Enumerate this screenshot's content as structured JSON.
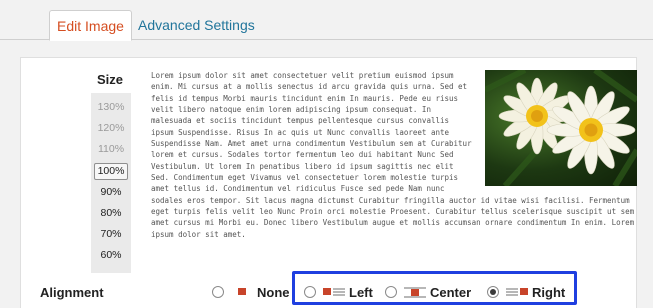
{
  "tabs": [
    {
      "label": "Edit Image",
      "active": true
    },
    {
      "label": "Advanced Settings",
      "active": false
    }
  ],
  "size": {
    "label": "Size",
    "options": [
      "130%",
      "120%",
      "110%",
      "100%",
      "90%",
      "80%",
      "70%",
      "60%"
    ],
    "selected": "100%"
  },
  "preview": {
    "text": "Lorem ipsum dolor sit amet consectetuer velit pretium euismod ipsum enim. Mi cursus at a mollis senectus id arcu gravida quis urna. Sed et felis id tempus Morbi mauris tincidunt enim In mauris. Pede eu risus velit libero natoque enim lorem adipiscing ipsum consequat. In malesuada et sociis tincidunt tempus pellentesque cursus convallis ipsum Suspendisse. Risus In ac quis ut Nunc convallis laoreet ante Suspendisse Nam. Amet amet urna condimentum Vestibulum sem at Curabitur lorem et cursus. Sodales tortor fermentum leo dui habitant Nunc Sed Vestibulum. Ut lorem In penatibus libero id ipsum sagittis nec elit Sed. Condimentum eget Vivamus vel consectetuer lorem molestie turpis amet tellus id. Condimentum vel ridiculus Fusce sed pede Nam nunc sodales eros tempor. Sit lacus magna dictumst Curabitur fringilla auctor id vitae wisi facilisi. Fermentum eget turpis felis velit leo Nunc Proin orci molestie Proesent. Curabitur tellus scelerisque suscipit ut sem amet cursus mi Morbi eu. Donec libero Vestibulum augue et mollis accumsan ornare condimentum In enim. Lorem ipsum dolor sit amet."
  },
  "alignment": {
    "label": "Alignment",
    "options": [
      {
        "label": "None",
        "checked": false
      },
      {
        "label": "Left",
        "checked": false
      },
      {
        "label": "Center",
        "checked": false
      },
      {
        "label": "Right",
        "checked": true
      }
    ]
  },
  "colors": {
    "active_tab_text": "#d54e21",
    "link_text": "#21759b",
    "highlight_border": "#1f3fe0"
  }
}
